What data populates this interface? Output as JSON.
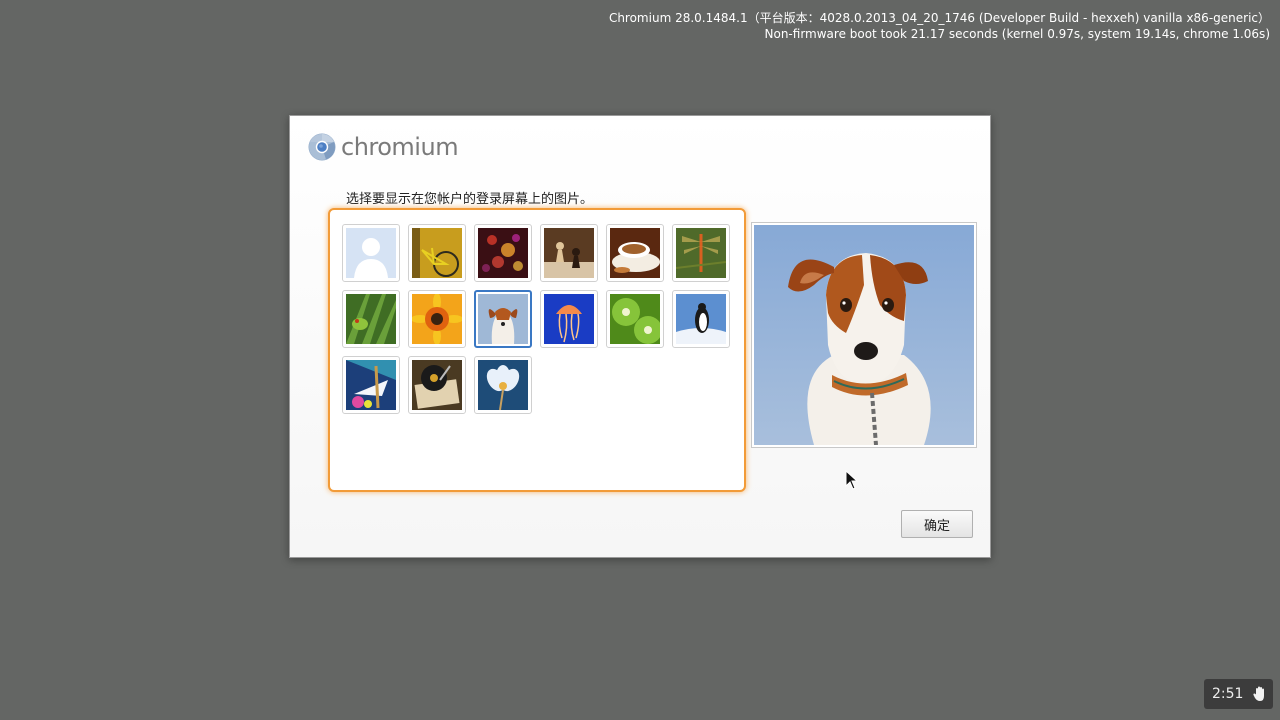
{
  "version": {
    "line1": "Chromium 28.0.1484.1（平台版本：4028.0.2013_04_20_1746 (Developer Build - hexxeh) vanilla x86-generic）",
    "line2": "Non-firmware boot took 21.17 seconds (kernel 0.97s, system 19.14s, chrome 1.06s)"
  },
  "dialog": {
    "brand": "chromium",
    "prompt": "选择要显示在您帐户的登录屏幕上的图片。",
    "ok_label": "确定"
  },
  "images": [
    {
      "name": "default-profile-image",
      "selected": false
    },
    {
      "name": "bicycle-image",
      "selected": false
    },
    {
      "name": "fireworks-bokeh-image",
      "selected": false
    },
    {
      "name": "chess-pieces-image",
      "selected": false
    },
    {
      "name": "coffee-cup-image",
      "selected": false
    },
    {
      "name": "dragonfly-image",
      "selected": false
    },
    {
      "name": "frog-on-leaves-image",
      "selected": false
    },
    {
      "name": "orange-flower-image",
      "selected": false
    },
    {
      "name": "puppy-image",
      "selected": true
    },
    {
      "name": "jellyfish-image",
      "selected": false
    },
    {
      "name": "kiwi-slices-image",
      "selected": false
    },
    {
      "name": "penguin-image",
      "selected": false
    },
    {
      "name": "paper-boat-image",
      "selected": false
    },
    {
      "name": "turntable-image",
      "selected": false
    },
    {
      "name": "white-flower-image",
      "selected": false
    }
  ],
  "preview": {
    "name": "puppy-preview-image"
  },
  "tray": {
    "time": "2:51",
    "icon": "hand-icon"
  }
}
